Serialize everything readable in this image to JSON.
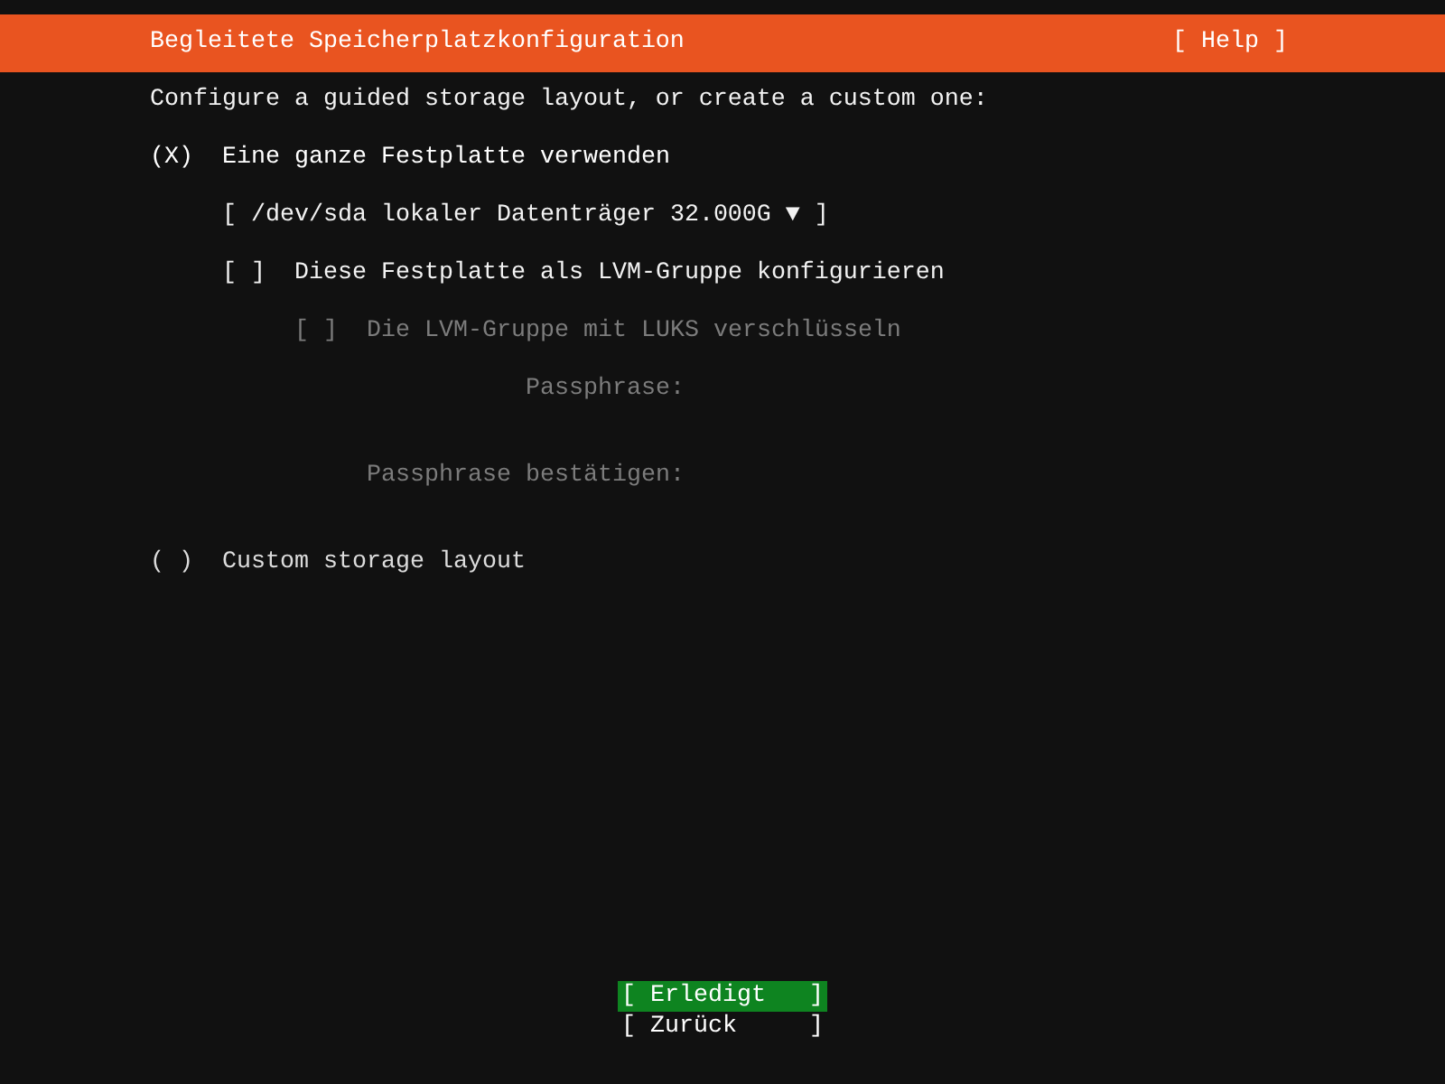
{
  "header": {
    "title": "Begleitete Speicherplatzkonfiguration",
    "help": "[ Help ]"
  },
  "intro": "Configure a guided storage layout, or create a custom one:",
  "options": [
    {
      "kind": "radio",
      "marker": "(X)",
      "label": "Eine ganze Festplatte verwenden",
      "selected": true
    },
    {
      "kind": "select",
      "text": "[ /dev/sda lokaler Datenträger 32.000G ▼ ]",
      "disabled": false
    },
    {
      "kind": "checkbox",
      "marker": "[ ]",
      "label": "Diese Festplatte als LVM-Gruppe konfigurieren",
      "checked": false,
      "disabled": false
    },
    {
      "kind": "subcheckbox",
      "marker": "[ ]",
      "label": "Die LVM-Gruppe mit LUKS verschlüsseln",
      "checked": false,
      "disabled": true
    },
    {
      "kind": "password",
      "label": "Passphrase:",
      "disabled": true
    },
    {
      "kind": "password",
      "label": "Passphrase bestätigen:",
      "disabled": true
    },
    {
      "kind": "radio",
      "marker": "( )",
      "label": "Custom storage layout",
      "selected": false
    }
  ],
  "buttons": [
    {
      "label": "[ Erledigt   ]",
      "selected": true
    },
    {
      "label": "[ Zurück     ]",
      "selected": false
    }
  ]
}
